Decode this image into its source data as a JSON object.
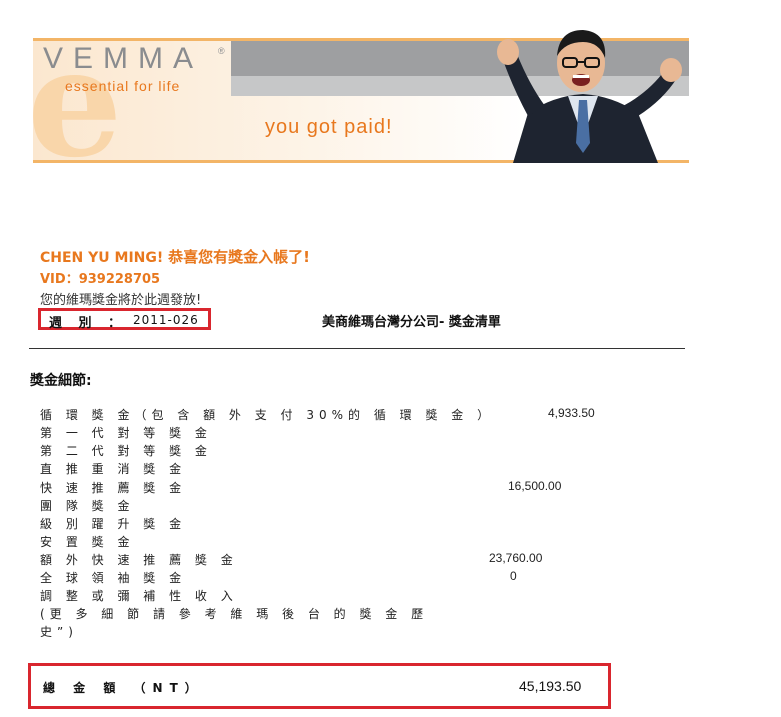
{
  "banner": {
    "logo_text": "VEMMA",
    "logo_mark": "®",
    "tagline": "essential for life",
    "slogan": "you got paid!",
    "photo_icon": "cheering-businessman-photo"
  },
  "header": {
    "greeting_name": "CHEN YU MING!",
    "greeting_msg": "恭喜您有獎金入帳了!",
    "vid": "VID：939228705",
    "notice": "您的維瑪獎金將於此週發放!",
    "week_label": "週 別 ：",
    "week_value": "2011-026",
    "company": "美商維瑪台灣分公司- 獎金清單"
  },
  "details": {
    "title": "獎金細節:",
    "rows": [
      {
        "label": "循 環 獎 金（包 含 額 外 支 付 30%的 循 環 獎 金 ）",
        "value": "4,933.50"
      },
      {
        "label": "第 一 代 對 等 獎 金",
        "value": ""
      },
      {
        "label": "第 二 代 對 等 獎 金",
        "value": ""
      },
      {
        "label": "直 推 重 消 獎 金",
        "value": ""
      },
      {
        "label": "快 速 推 薦 獎 金",
        "value": "16,500.00"
      },
      {
        "label": "團 隊 獎 金",
        "value": ""
      },
      {
        "label": "級 別 躍 升 獎 金",
        "value": ""
      },
      {
        "label": "安 置 獎 金",
        "value": ""
      },
      {
        "label": "額 外 快 速 推 薦 獎 金",
        "value": "23,760.00"
      },
      {
        "label": "全 球 領 袖 獎 金",
        "value": "0"
      },
      {
        "label": "調 整 或 彌 補 性 收 入",
        "value": ""
      },
      {
        "label": "(更 多 細 節 請 參 考 維 瑪 後 台 的 獎 金 歷",
        "value": ""
      },
      {
        "label": "史”)",
        "value": ""
      }
    ]
  },
  "total": {
    "label": "總 金 額 （NT）",
    "value": "45,193.50"
  },
  "colors": {
    "accent": "#e8781e",
    "highlight_border": "#d9262e"
  }
}
